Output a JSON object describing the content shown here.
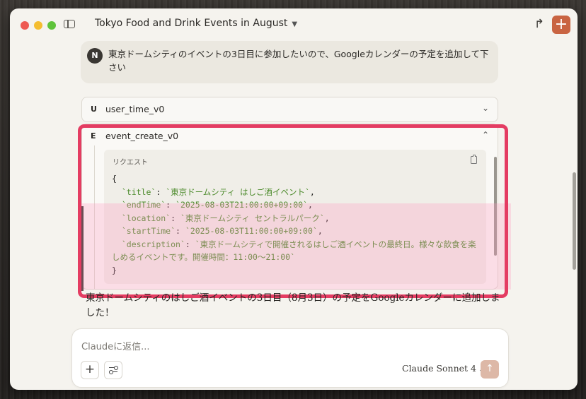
{
  "window": {
    "title": "Tokyo Food and Drink Events in August"
  },
  "user_message": {
    "avatar_initial": "N",
    "text": "東京ドームシティのイベントの3日目に参加したいので、Googleカレンダーの予定を追加して下さい"
  },
  "tools": [
    {
      "letter": "U",
      "name": "user_time_v0",
      "expanded": false
    },
    {
      "letter": "E",
      "name": "event_create_v0",
      "expanded": true
    }
  ],
  "request": {
    "label": "リクエスト",
    "open_brace": "{",
    "close_brace": "}",
    "fields": [
      {
        "key": "`title`",
        "value": "`東京ドームシティ はしご酒イベント`",
        "sep": ","
      },
      {
        "key": "`endTime`",
        "value": "`2025-08-03T21:00:00+09:00`",
        "sep": ","
      },
      {
        "key": "`location`",
        "value": "`東京ドームシティ セントラルパーク`",
        "sep": ","
      },
      {
        "key": "`startTime`",
        "value": "`2025-08-03T11:00:00+09:00`",
        "sep": ","
      },
      {
        "key": "`description`",
        "value": "`東京ドームシティで開催されるはしご酒イベントの最終日。様々な飲食を楽しめるイベントです。開催時間：11:00〜21:00`",
        "sep": ""
      }
    ]
  },
  "assistant_message": {
    "text": "東京ドームシティのはしご酒イベントの3日目（8月3日）の予定をGoogleカレンダーに追加しました！"
  },
  "composer": {
    "placeholder": "Claudeに返信...",
    "model": "Claude Sonnet 4"
  },
  "colors": {
    "accent": "#c96442",
    "highlight": "#e43c62"
  }
}
